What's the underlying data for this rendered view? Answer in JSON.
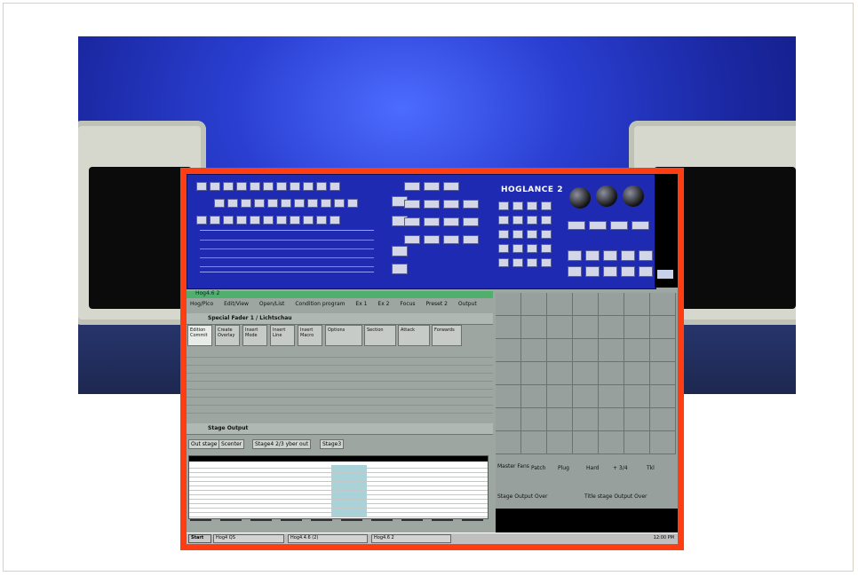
{
  "app": {
    "brand": "HOGLANCE 2",
    "window_title": "Hog4.6 2",
    "menu": [
      "Hog/Pico",
      "Edit/View",
      "Open/List",
      "Condition program",
      "Ex 1",
      "Ex 2",
      "Focus",
      "Preset 2",
      "Output"
    ],
    "panel1_title": "Special Fader 1 / Lichtschau",
    "tabs": [
      "Edition Commit",
      "Create Overlay",
      "Insert Mode",
      "Insert Line",
      "Insert Macro",
      "Options",
      "Section",
      "Attack",
      "Forwards"
    ],
    "panel2_title": "Stage Output",
    "output_tabs": [
      "Out stage",
      "Scenter",
      "Stage4 2/3 yber out",
      "Stage3"
    ],
    "right_footer": [
      "Stage Output Over",
      "Title stage Output Over"
    ],
    "right_buttons": [
      "Patch",
      "Plug",
      "Hard",
      "+ 3/4",
      "Tkl"
    ],
    "right_label": "Master Fans",
    "taskbar": {
      "start": "Start",
      "items": [
        "Hog4 QS",
        "Hog4.4.6 (2)",
        "Hog4.6 2"
      ],
      "clock": "12:00 PM"
    }
  },
  "colors": {
    "accent": "#ff3d12",
    "keypad": "#1f2ab2",
    "titlebar": "#4faf6d"
  }
}
